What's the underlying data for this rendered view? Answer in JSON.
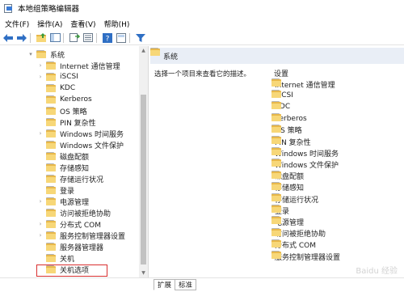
{
  "window": {
    "title": "本地组策略编辑器"
  },
  "menu": {
    "items": [
      "文件(F)",
      "操作(A)",
      "查看(V)",
      "帮助(H)"
    ]
  },
  "toolbar": {
    "icons": [
      "back-arrow-icon",
      "forward-arrow-icon",
      "up-folder-icon",
      "show-hide-tree-icon",
      "export-list-icon",
      "properties-icon",
      "help-icon",
      "filter-icon"
    ]
  },
  "tree": {
    "root_label": "系统",
    "items": [
      {
        "label": "Internet 通信管理",
        "has_children": true
      },
      {
        "label": "iSCSI",
        "has_children": true
      },
      {
        "label": "KDC",
        "has_children": false
      },
      {
        "label": "Kerberos",
        "has_children": false
      },
      {
        "label": "OS 策略",
        "has_children": false
      },
      {
        "label": "PIN 复杂性",
        "has_children": false
      },
      {
        "label": "Windows 时间服务",
        "has_children": true
      },
      {
        "label": "Windows 文件保护",
        "has_children": false
      },
      {
        "label": "磁盘配额",
        "has_children": false
      },
      {
        "label": "存储感知",
        "has_children": false
      },
      {
        "label": "存储运行状况",
        "has_children": false
      },
      {
        "label": "登录",
        "has_children": false
      },
      {
        "label": "电源管理",
        "has_children": true
      },
      {
        "label": "访问被拒绝协助",
        "has_children": false
      },
      {
        "label": "分布式 COM",
        "has_children": true
      },
      {
        "label": "服务控制管理器设置",
        "has_children": true
      },
      {
        "label": "服务器管理器",
        "has_children": false
      },
      {
        "label": "关机",
        "has_children": false
      },
      {
        "label": "关机选项",
        "has_children": false
      }
    ]
  },
  "right": {
    "header": "系统",
    "description": "选择一个项目来查看它的描述。",
    "column_header": "设置",
    "items": [
      "Internet 通信管理",
      "iSCSI",
      "KDC",
      "Kerberos",
      "OS 策略",
      "PIN 复杂性",
      "Windows 时间服务",
      "Windows 文件保护",
      "磁盘配额",
      "存储感知",
      "存储运行状况",
      "登录",
      "电源管理",
      "访问被拒绝协助",
      "分布式 COM",
      "服务控制管理器设置"
    ]
  },
  "tabs": {
    "items": [
      "扩展",
      "标准"
    ],
    "active": "扩展"
  },
  "watermark": "Baidu 经验",
  "colors": {
    "folder": "#f7d778",
    "folder_dark": "#e8b84a",
    "header_bg": "#e9eef6",
    "highlight": "#d93030"
  }
}
